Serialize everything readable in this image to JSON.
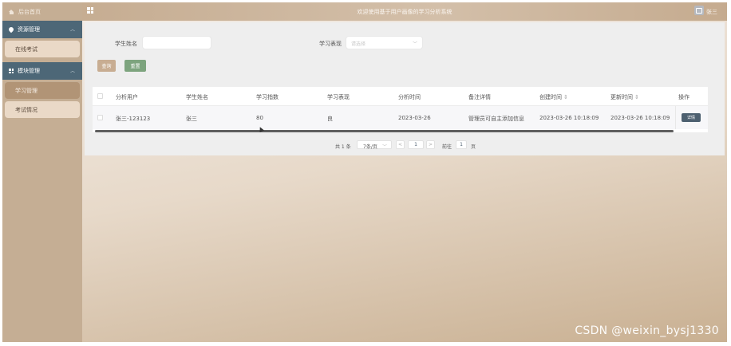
{
  "sidebar": {
    "home_label": "后台首页",
    "groups": [
      {
        "label": "资源管理",
        "items": [
          {
            "label": "在线考试",
            "active": false
          }
        ]
      },
      {
        "label": "模块管理",
        "items": [
          {
            "label": "学习管理",
            "active": true
          },
          {
            "label": "考试情况",
            "active": false
          }
        ]
      }
    ],
    "colors": {
      "background": "#c5ae94",
      "group": "#4d6777",
      "item": "#ead9c7",
      "item_active": "#b19476"
    }
  },
  "header": {
    "title": "欢迎使用基于用户画像的学习分析系统",
    "username": "张三"
  },
  "search": {
    "name_label": "学生姓名",
    "name_value": "",
    "performance_label": "学习表现",
    "performance_placeholder": "请选择",
    "query_button": "查询",
    "reset_button": "重置"
  },
  "table": {
    "columns": [
      "分析用户",
      "学生姓名",
      "学习指数",
      "学习表现",
      "分析时间",
      "备注详情",
      "创建时间",
      "更新时间",
      "操作"
    ],
    "sortable_marker": "⇕",
    "rows": [
      {
        "user": "张三-123123",
        "name": "张三",
        "index": "80",
        "performance": "良",
        "analysis_time": "2023-03-26",
        "remark": "管理员可自主添加信息",
        "created": "2023-03-26 10:18:09",
        "updated": "2023-03-26 10:18:09",
        "action": "详情"
      }
    ]
  },
  "pagination": {
    "total": "共 1 条",
    "page_size": "7条/页",
    "prev": "<",
    "current_page": "1",
    "next": ">",
    "goto_label": "前往",
    "goto_value": "1",
    "page_suffix": "页"
  },
  "watermark": "CSDN @weixin_bysj1330"
}
